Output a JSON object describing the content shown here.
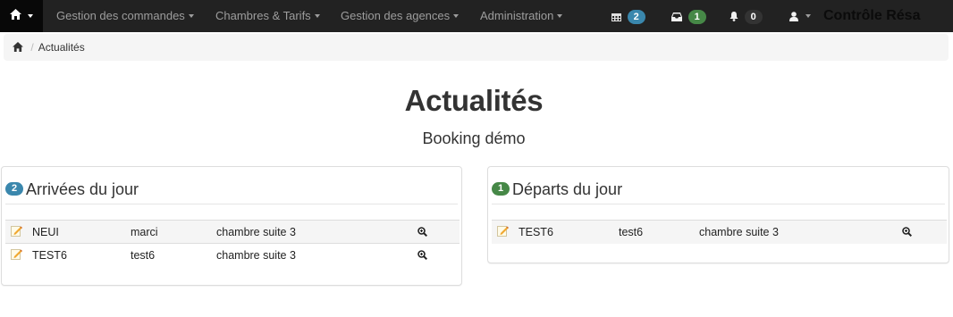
{
  "navbar": {
    "menus": [
      {
        "label": "Gestion des commandes"
      },
      {
        "label": "Chambres & Tarifs"
      },
      {
        "label": "Gestion des agences"
      },
      {
        "label": "Administration"
      }
    ],
    "badges": {
      "calendar": {
        "count": "2",
        "color": "#3a87ad"
      },
      "inbox": {
        "count": "1",
        "color": "#468847"
      },
      "notifications": {
        "count": "0",
        "color": "#333333"
      }
    },
    "right_title": "Contrôle Résa"
  },
  "breadcrumb": {
    "current": "Actualités"
  },
  "page": {
    "title": "Actualités",
    "subtitle": "Booking démo"
  },
  "arrivals": {
    "count": "2",
    "count_color": "#3a87ad",
    "heading": "Arrivées du jour",
    "rows": [
      {
        "name": "NEUI",
        "client": "marci",
        "room": "chambre suite 3"
      },
      {
        "name": "TEST6",
        "client": "test6",
        "room": "chambre suite 3"
      }
    ]
  },
  "departures": {
    "count": "1",
    "count_color": "#468847",
    "heading": "Départs du jour",
    "rows": [
      {
        "name": "TEST6",
        "client": "test6",
        "room": "chambre suite 3"
      }
    ]
  },
  "icons": {
    "home": "home-icon",
    "calendar": "calendar-icon",
    "inbox": "inbox-icon",
    "bell": "bell-icon",
    "user": "user-icon",
    "edit": "edit-icon",
    "zoom": "zoom-in-icon"
  }
}
